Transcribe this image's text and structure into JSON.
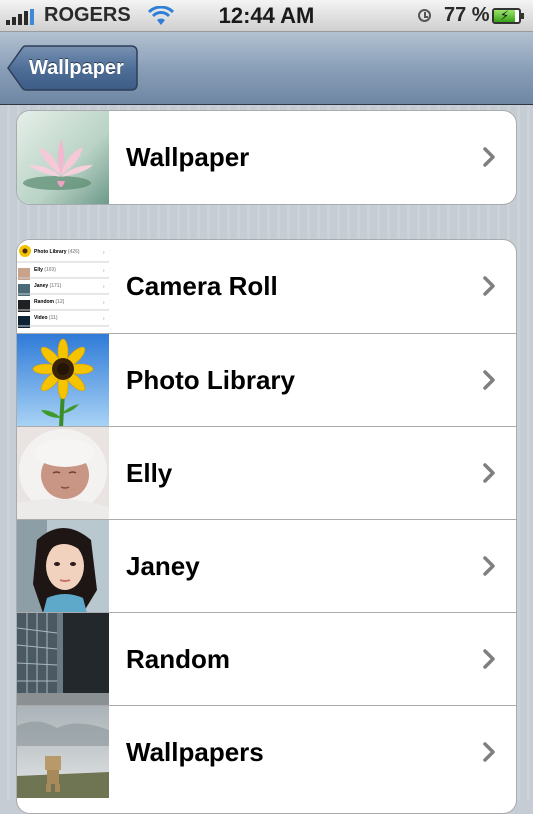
{
  "status_bar": {
    "carrier": "ROGERS",
    "time": "12:44 AM",
    "battery_percent": "77 %",
    "signal_icon": "signal-bars-icon",
    "wifi_icon": "wifi-icon",
    "alarm_icon": "alarm-clock-icon",
    "battery_icon": "battery-charging-icon"
  },
  "nav_bar": {
    "back_label": "Wallpaper"
  },
  "groups": [
    {
      "rows": [
        {
          "label": "Wallpaper",
          "thumbnail": "lotus-flower-thumbnail"
        }
      ]
    },
    {
      "rows": [
        {
          "label": "Camera Roll",
          "thumbnail": "camera-roll-list-thumbnail",
          "preview_items": [
            {
              "label": "Photo Library",
              "count": "(426)"
            },
            {
              "label": "Elly",
              "count": "(103)"
            },
            {
              "label": "Janey",
              "count": "(171)"
            },
            {
              "label": "Random",
              "count": "(12)"
            },
            {
              "label": "Video",
              "count": "(11)"
            }
          ]
        },
        {
          "label": "Photo Library",
          "thumbnail": "sunflower-thumbnail"
        },
        {
          "label": "Elly",
          "thumbnail": "baby-thumbnail"
        },
        {
          "label": "Janey",
          "thumbnail": "portrait-thumbnail"
        },
        {
          "label": "Random",
          "thumbnail": "building-thumbnail"
        },
        {
          "label": "Wallpapers",
          "thumbnail": "danbo-thumbnail"
        }
      ]
    }
  ],
  "colors": {
    "nav_bar": "#7f95b0",
    "back_button": "#4a6a92",
    "background_stripe": "#c5ccd4",
    "chevron": "#7f7f7f"
  }
}
